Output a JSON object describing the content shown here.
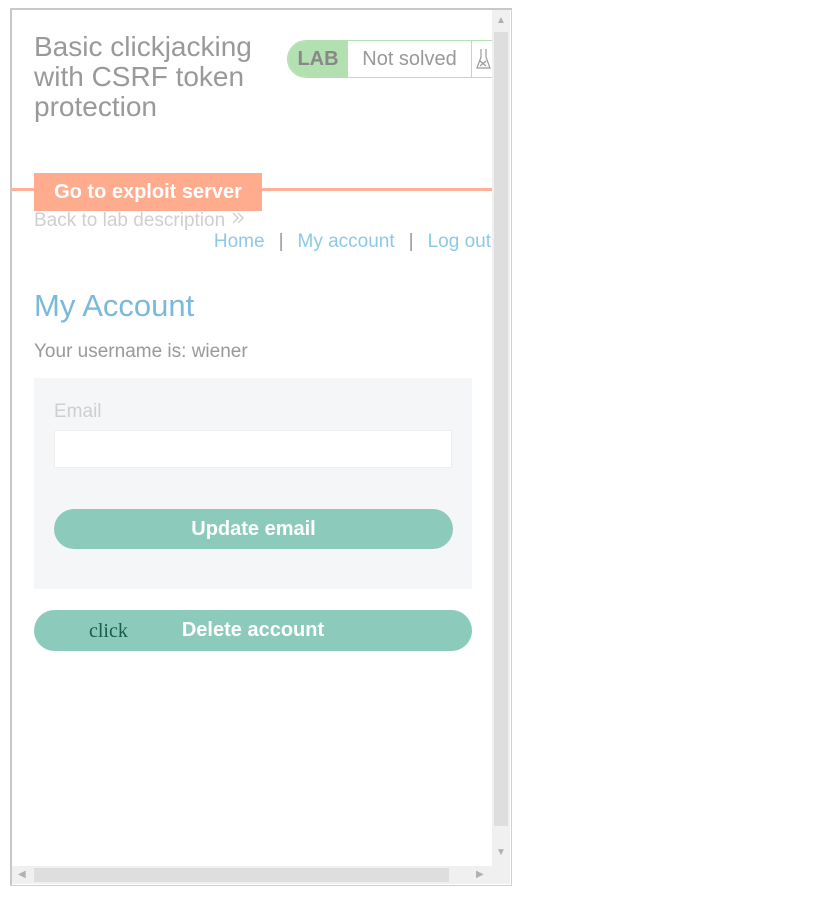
{
  "page": {
    "title": "Basic clickjacking with CSRF token protection",
    "lab_tag": "LAB",
    "lab_status": "Not solved",
    "exploit_button": "Go to exploit server",
    "back_link": "Back to lab description",
    "nav": {
      "home": "Home",
      "my_account": "My account",
      "log_out": "Log out",
      "separator": "|"
    },
    "account_heading": "My Account",
    "username_text": "Your username is: wiener",
    "email_label": "Email",
    "email_value": "",
    "update_button": "Update email",
    "delete_button": "Delete account",
    "decoy_text": "click"
  },
  "colors": {
    "accent_orange": "#ffab8e",
    "lab_green": "#b3e0b0",
    "button_teal": "#8ccbbb",
    "link_blue": "#8cc9e6",
    "heading_blue": "#7ab8dc"
  },
  "icons": {
    "lab_icon": "flask-icon",
    "back_icon": "double-chevron-right-icon"
  }
}
